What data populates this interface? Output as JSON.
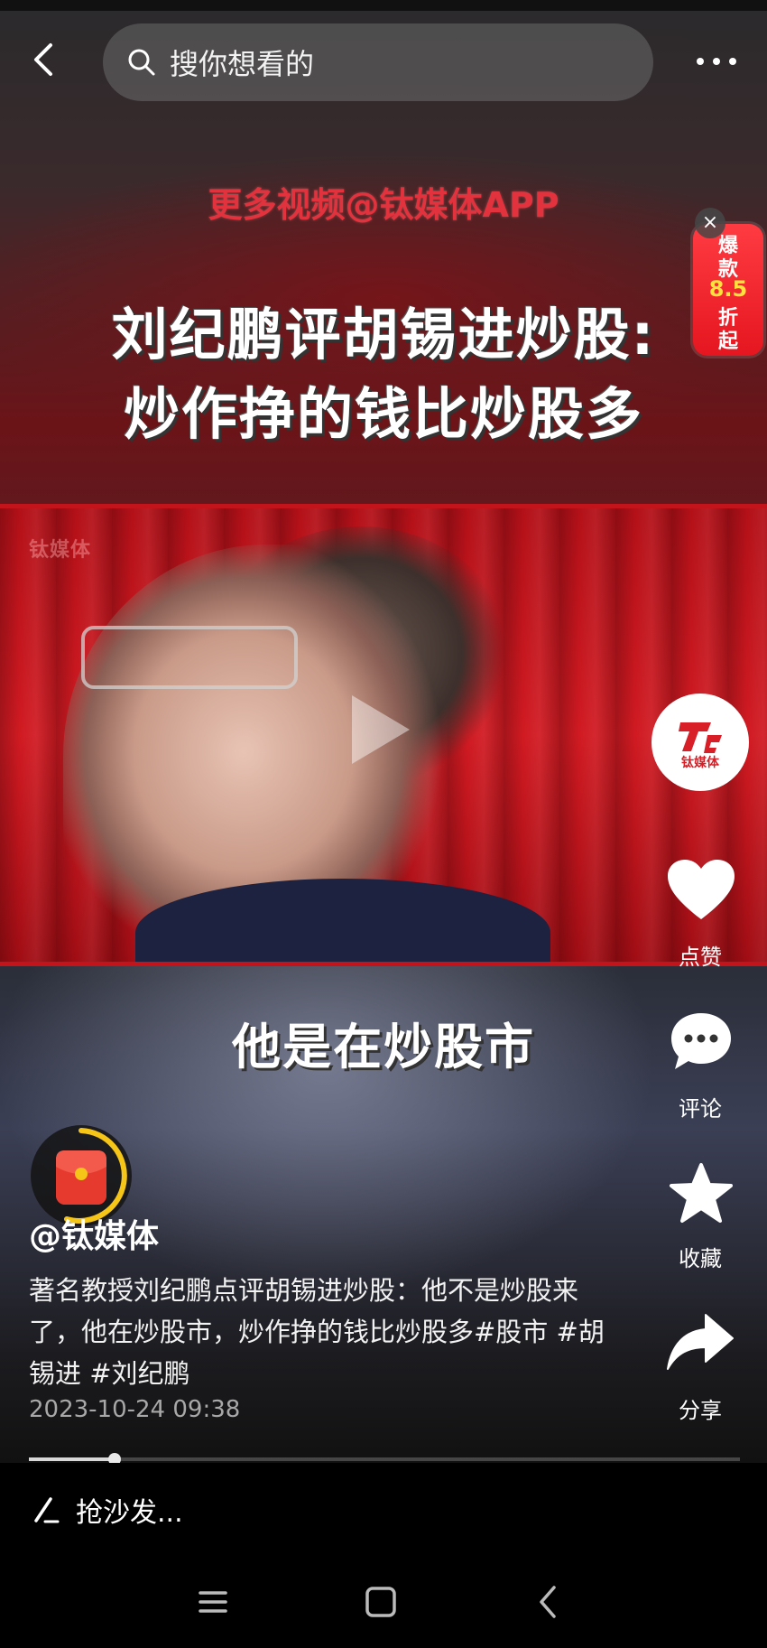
{
  "header": {
    "search_placeholder": "搜你想看的",
    "back_icon": "chevron-left-icon",
    "more_icon": "more-horizontal-icon"
  },
  "video": {
    "overlay_top": "更多视频@钛媒体APP",
    "title_line1": "刘纪鹏评胡锡进炒股:",
    "title_line2": "炒作挣的钱比炒股多",
    "subtitle": "他是在炒股市",
    "watermark": "钛媒体",
    "promo": {
      "line1": "爆",
      "line2": "款",
      "discount": "8.5",
      "line3": "折",
      "line4": "起",
      "close": "×"
    }
  },
  "side_actions": {
    "channel_logo_text": "钛媒体",
    "like_label": "点赞",
    "comment_label": "评论",
    "favorite_label": "收藏",
    "share_label": "分享"
  },
  "post": {
    "author": "@钛媒体",
    "description": "著名教授刘纪鹏点评胡锡进炒股：他不是炒股来了，他在炒股市，炒作挣的钱比炒股多#股市 #胡锡进 #刘纪鹏",
    "timestamp": "2023-10-24 09:38",
    "progress": 0.12
  },
  "comment_bar": {
    "placeholder": "抢沙发..."
  },
  "colors": {
    "accent_red": "#e5161f",
    "ring_yellow": "#f5c518"
  }
}
